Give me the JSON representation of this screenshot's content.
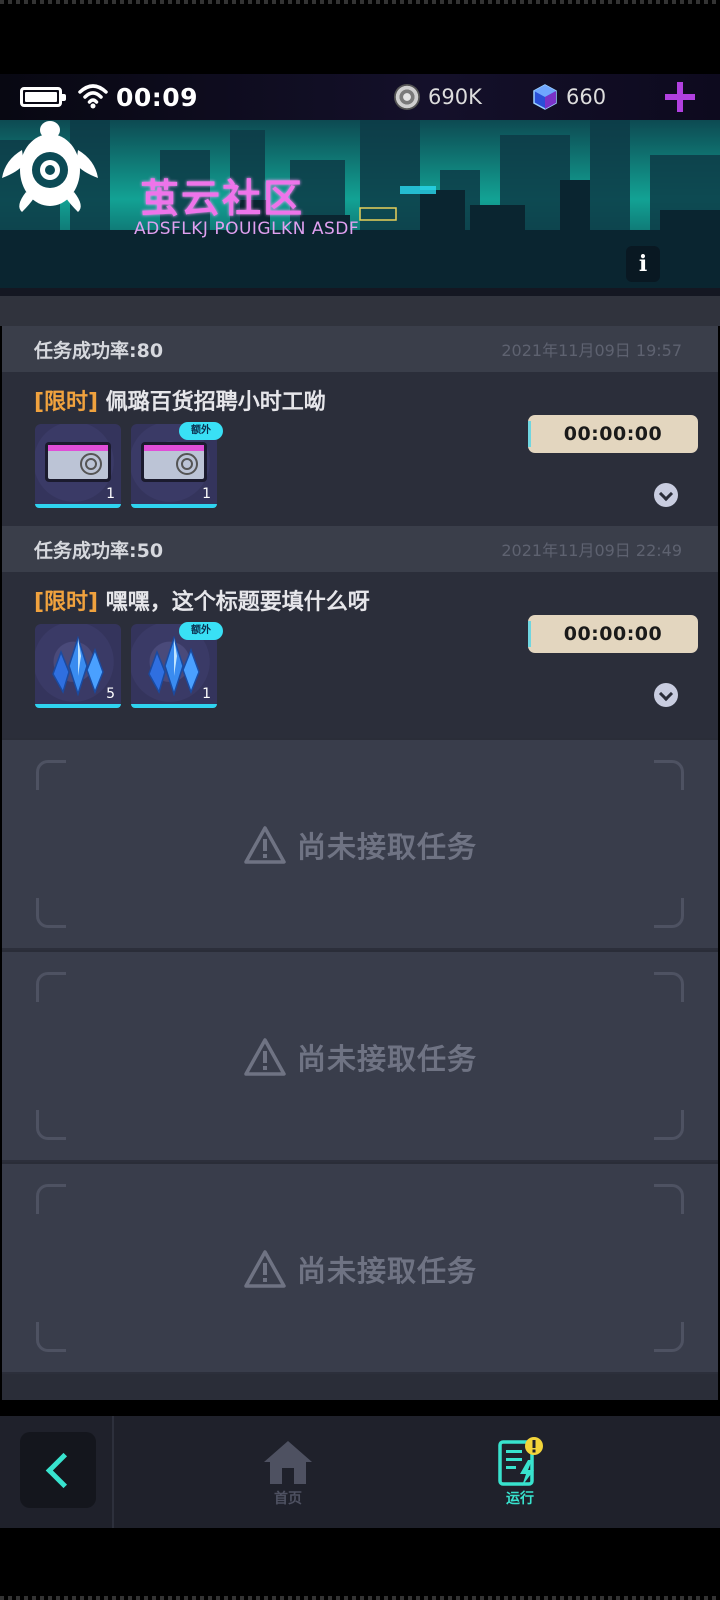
{
  "status_bar": {
    "time": "00:09",
    "coins": "690K",
    "gems": "660"
  },
  "banner": {
    "title": "茧云社区",
    "subtitle": "ADSFLKJ POUIGLKN ASDF",
    "info_label": "i"
  },
  "tasks": [
    {
      "rate": "任务成功率:80",
      "date": "2021年11月09日 19:57",
      "tag": "[限时]",
      "title": "佩璐百货招聘小时工呦",
      "timer": "00:00:00",
      "rewards": [
        {
          "icon": "card-icon",
          "count": "1",
          "extra": ""
        },
        {
          "icon": "card-icon",
          "count": "1",
          "extra": "额外"
        }
      ]
    },
    {
      "rate": "任务成功率:50",
      "date": "2021年11月09日 22:49",
      "tag": "[限时]",
      "title": "嘿嘿，这个标题要填什么呀",
      "timer": "00:00:00",
      "rewards": [
        {
          "icon": "crystal-icon",
          "count": "5",
          "extra": ""
        },
        {
          "icon": "crystal-icon",
          "count": "1",
          "extra": "额外"
        }
      ]
    }
  ],
  "empty_slots": [
    {
      "message": "尚未接取任务"
    },
    {
      "message": "尚未接取任务"
    },
    {
      "message": "尚未接取任务"
    }
  ],
  "nav": {
    "home_label": "首页",
    "run_label": "运行"
  },
  "colors": {
    "accent": "#38e3ce",
    "tag": "#f0a23e",
    "title_pink": "#ee74ea",
    "timer_bg": "#e3d6bf"
  }
}
